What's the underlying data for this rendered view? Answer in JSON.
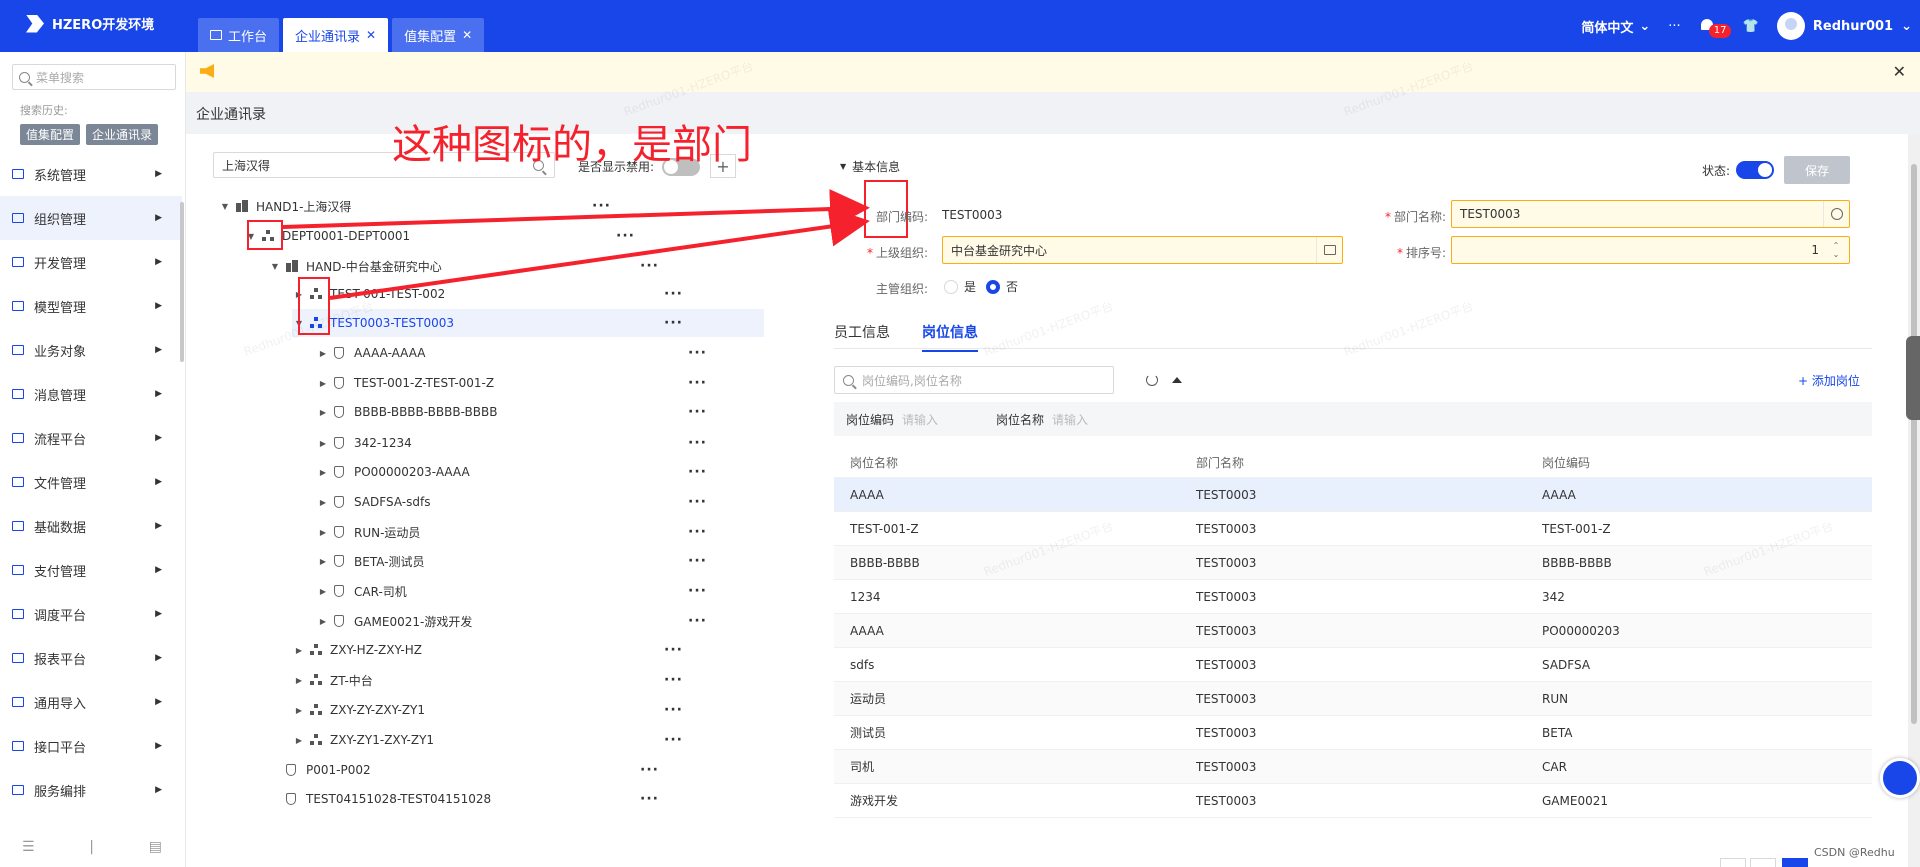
{
  "app": {
    "title": "HZERO开发环境"
  },
  "tabs": [
    {
      "label": "工作台",
      "closable": false,
      "active": false
    },
    {
      "label": "企业通讯录",
      "closable": true,
      "active": true
    },
    {
      "label": "值集配置",
      "closable": true,
      "active": false
    }
  ],
  "header": {
    "language": "简体中文",
    "notification_count": "17",
    "username": "Redhur001"
  },
  "sidebar": {
    "search_placeholder": "菜单搜索",
    "history_label": "搜索历史:",
    "history": [
      "值集配置",
      "企业通讯录"
    ],
    "items": [
      {
        "label": "系统管理"
      },
      {
        "label": "组织管理"
      },
      {
        "label": "开发管理"
      },
      {
        "label": "模型管理"
      },
      {
        "label": "业务对象"
      },
      {
        "label": "消息管理"
      },
      {
        "label": "流程平台"
      },
      {
        "label": "文件管理"
      },
      {
        "label": "基础数据"
      },
      {
        "label": "支付管理"
      },
      {
        "label": "调度平台"
      },
      {
        "label": "报表平台"
      },
      {
        "label": "通用导入"
      },
      {
        "label": "接口平台"
      },
      {
        "label": "服务编排"
      }
    ]
  },
  "breadcrumb": "企业通讯录",
  "annotation": "这种图标的，是部门",
  "tree": {
    "search_value": "上海汉得",
    "show_disabled_label": "是否显示禁用:",
    "add_label": "+",
    "more": "···",
    "nodes": [
      {
        "label": "HAND1-上海汉得"
      },
      {
        "label": "DEPT0001-DEPT0001"
      },
      {
        "label": "HAND-中台基金研究中心"
      },
      {
        "label": "TEST-001-TEST-002"
      },
      {
        "label": "TEST0003-TEST0003"
      },
      {
        "label": "AAAA-AAAA"
      },
      {
        "label": "TEST-001-Z-TEST-001-Z"
      },
      {
        "label": "BBBB-BBBB-BBBB-BBBB"
      },
      {
        "label": "342-1234"
      },
      {
        "label": "PO00000203-AAAA"
      },
      {
        "label": "SADFSA-sdfs"
      },
      {
        "label": "RUN-运动员"
      },
      {
        "label": "BETA-测试员"
      },
      {
        "label": "CAR-司机"
      },
      {
        "label": "GAME0021-游戏开发"
      },
      {
        "label": "ZXY-HZ-ZXY-HZ"
      },
      {
        "label": "ZT-中台"
      },
      {
        "label": "ZXY-ZY-ZXY-ZY1"
      },
      {
        "label": "ZXY-ZY1-ZXY-ZY1"
      },
      {
        "label": "P001-P002"
      },
      {
        "label": "TEST04151028-TEST04151028"
      }
    ]
  },
  "form": {
    "section_title": "基本信息",
    "status_label": "状态:",
    "save_label": "保存",
    "dept_code_label": "部门编码:",
    "dept_code_value": "TEST0003",
    "dept_name_label": "部门名称:",
    "dept_name_value": "TEST0003",
    "parent_org_label": "上级组织:",
    "parent_org_value": "中台基金研究中心",
    "sort_label": "排序号:",
    "sort_value": "1",
    "main_org_label": "主管组织:",
    "yes_label": "是",
    "no_label": "否"
  },
  "subtabs": [
    "员工信息",
    "岗位信息"
  ],
  "posts": {
    "search_placeholder": "岗位编码,岗位名称",
    "add_label": "+ 添加岗位",
    "filter_code_label": "岗位编码",
    "filter_name_label": "岗位名称",
    "filter_placeholder": "请输入",
    "columns": [
      "岗位名称",
      "部门名称",
      "岗位编码"
    ],
    "rows": [
      [
        "AAAA",
        "TEST0003",
        "AAAA"
      ],
      [
        "TEST-001-Z",
        "TEST0003",
        "TEST-001-Z"
      ],
      [
        "BBBB-BBBB",
        "TEST0003",
        "BBBB-BBBB"
      ],
      [
        "1234",
        "TEST0003",
        "342"
      ],
      [
        "AAAA",
        "TEST0003",
        "PO00000203"
      ],
      [
        "sdfs",
        "TEST0003",
        "SADFSA"
      ],
      [
        "运动员",
        "TEST0003",
        "RUN"
      ],
      [
        "测试员",
        "TEST0003",
        "BETA"
      ],
      [
        "司机",
        "TEST0003",
        "CAR"
      ],
      [
        "游戏开发",
        "TEST0003",
        "GAME0021"
      ]
    ]
  },
  "credit": "CSDN @Redhu",
  "watermark": "Redhur001-HZERO平台",
  "colors": {
    "primary": "#1846e9",
    "annotation": "#f5222d",
    "notice_bg": "#fffbe6"
  }
}
